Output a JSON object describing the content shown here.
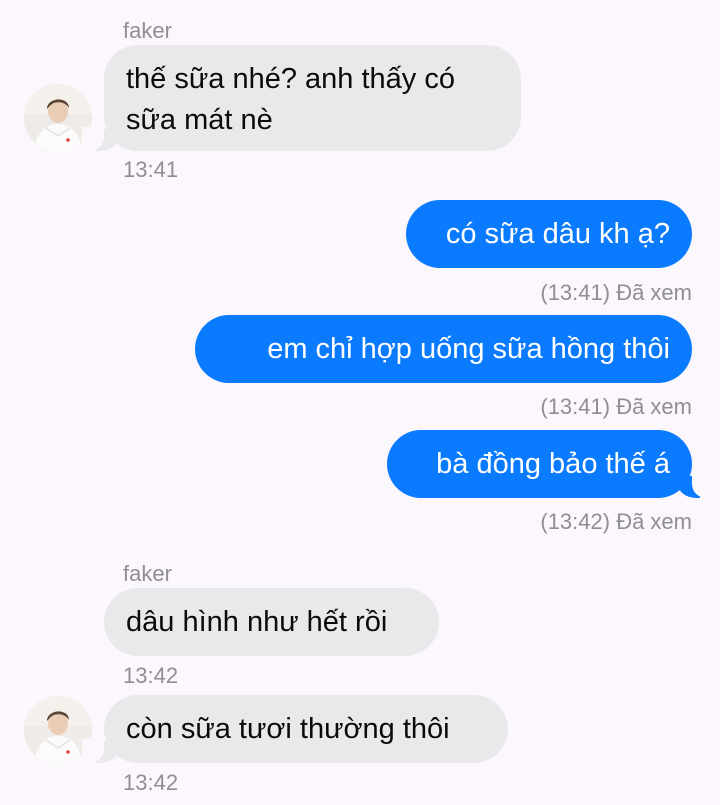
{
  "colors": {
    "background": "#fcf7fc",
    "incoming_bubble": "#e9e9eb",
    "outgoing_bubble": "#0a7bff",
    "meta_text": "#8e8e93"
  },
  "messages": [
    {
      "sender": "faker",
      "text_lines": [
        "thế sữa nhé? anh thấy có",
        "sữa mát nè"
      ],
      "time": "13:41"
    },
    {
      "text": "có sữa dâu kh ạ?",
      "time": "(13:41) Đã xem"
    },
    {
      "text": "em chỉ hợp uống sữa hồng thôi",
      "time": "(13:41) Đã xem"
    },
    {
      "text": "bà đồng bảo thế á",
      "time": "(13:42) Đã xem"
    },
    {
      "sender": "faker",
      "text": "dâu hình như hết rồi",
      "time": "13:42"
    },
    {
      "text": "còn sữa tươi thường thôi",
      "time": "13:42"
    }
  ]
}
